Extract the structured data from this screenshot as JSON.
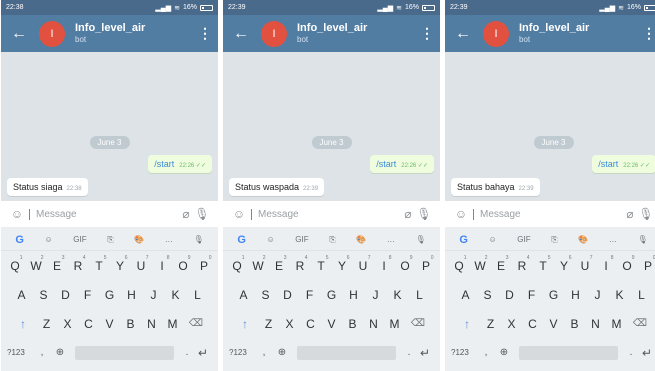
{
  "panels": [
    {
      "time": "22:38",
      "battery": "16%",
      "title": "Info_level_air",
      "subtitle": "bot",
      "avatar_letter": "I",
      "date": "June 3",
      "sent": "/start",
      "sent_time": "22:26",
      "received": "Status siaga",
      "received_time": "22:38",
      "placeholder": "Message"
    },
    {
      "time": "22:39",
      "battery": "16%",
      "title": "Info_level_air",
      "subtitle": "bot",
      "avatar_letter": "I",
      "date": "June 3",
      "sent": "/start",
      "sent_time": "22:26",
      "received": "Status waspada",
      "received_time": "22:39",
      "placeholder": "Message"
    },
    {
      "time": "22:39",
      "battery": "16%",
      "title": "Info_level_air",
      "subtitle": "bot",
      "avatar_letter": "I",
      "date": "June 3",
      "sent": "/start",
      "sent_time": "22:26",
      "received": "Status bahaya",
      "received_time": "22:39",
      "placeholder": "Message"
    }
  ],
  "keyboard": {
    "toolbar": [
      "G",
      "☺",
      "GIF",
      "⎘",
      "🎨",
      "…",
      "🎙"
    ],
    "row1": [
      "Q",
      "W",
      "E",
      "R",
      "T",
      "Y",
      "U",
      "I",
      "O",
      "P"
    ],
    "row1_hints": [
      "1",
      "2",
      "3",
      "4",
      "5",
      "6",
      "7",
      "8",
      "9",
      "0"
    ],
    "row2": [
      "A",
      "S",
      "D",
      "F",
      "G",
      "H",
      "J",
      "K",
      "L"
    ],
    "row3": [
      "Z",
      "X",
      "C",
      "V",
      "B",
      "N",
      "M"
    ],
    "n123": "?123",
    "comma": ",",
    "period": "."
  },
  "colors": {
    "header": "#527da3",
    "statusbar": "#4a6a8c",
    "avatar": "#e2513f",
    "outgoing": "#effdde",
    "chat_bg": "#dde3e7"
  }
}
